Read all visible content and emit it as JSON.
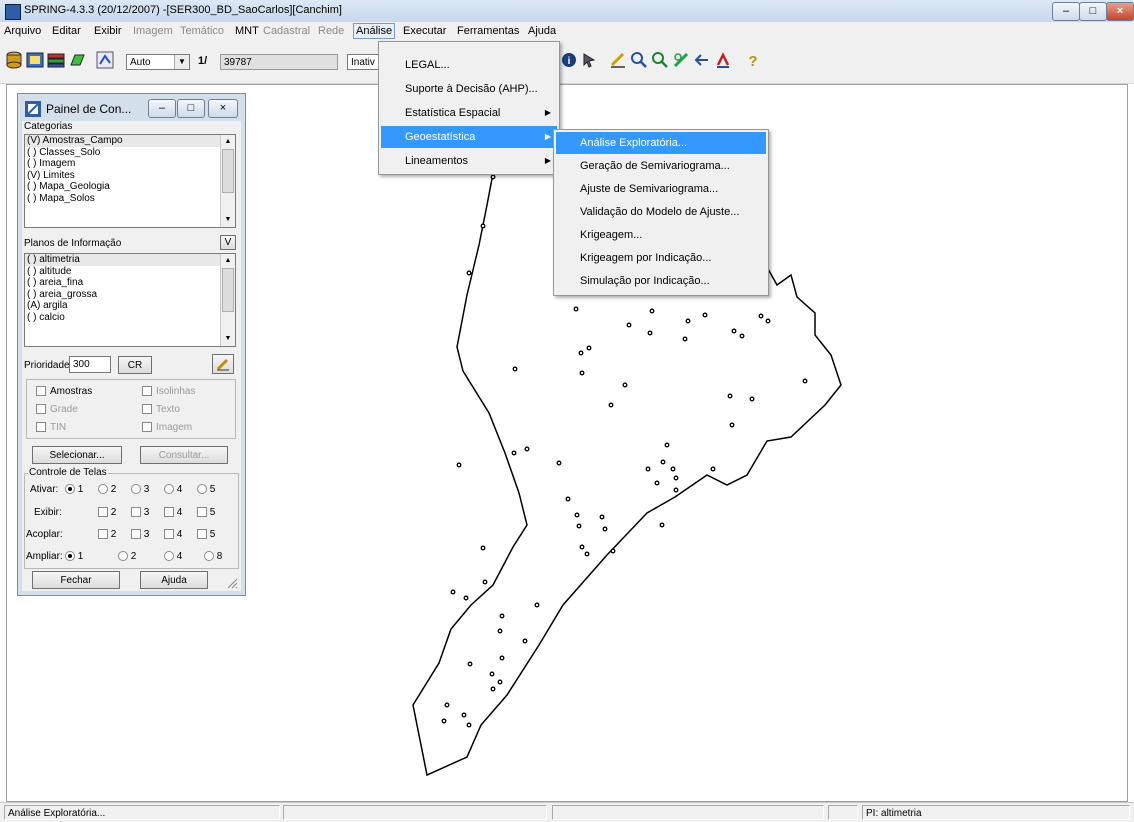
{
  "window": {
    "title": "SPRING-4.3.3 (20/12/2007) -[SER300_BD_SaoCarlos][Canchim]"
  },
  "menubar": {
    "items": [
      "Arquivo",
      "Editar",
      "Exibir",
      "Imagem",
      "Temático",
      "MNT",
      "Cadastral",
      "Rede",
      "Análise",
      "Executar",
      "Ferramentas",
      "Ajuda"
    ],
    "active": "Análise"
  },
  "toolbar": {
    "mode_combo": "Auto",
    "scale_prefix": "1/",
    "scale_value": "39787",
    "inactive_field": "Inativ"
  },
  "panel": {
    "title": "Painel de Con...",
    "categories_label": "Categorias",
    "categories": [
      "(V) Amostras_Campo",
      "( ) Classes_Solo",
      "( ) Imagem",
      "(V) Limites",
      "( ) Mapa_Geologia",
      "( ) Mapa_Solos"
    ],
    "planes_label": "Planos de Informação",
    "planes_button": "V",
    "planes": [
      "( ) altimetria",
      "( ) altitude",
      "( ) areia_fina",
      "( ) areia_grossa",
      "(A) argila",
      "( ) calcio"
    ],
    "priority_label": "Prioridade:",
    "priority_value": "300",
    "cr_button": "CR",
    "checks": {
      "amostras": "Amostras",
      "isolinhas": "Isolinhas",
      "grade": "Grade",
      "texto": "Texto",
      "tin": "TIN",
      "imagem": "Imagem"
    },
    "select_button": "Selecionar...",
    "query_button": "Consultar...",
    "screens_group": "Controle de Telas",
    "ativar_label": "Ativar:",
    "exibir_label": "Exibir:",
    "acoplar_label": "Acoplar:",
    "ampliar_label": "Ampliar:",
    "screen_numbers": [
      "1",
      "2",
      "3",
      "4",
      "5"
    ],
    "zoom_options": [
      "1",
      "2",
      "4",
      "8"
    ],
    "close_button": "Fechar",
    "help_button": "Ajuda"
  },
  "analise_menu": {
    "items": [
      "LEGAL...",
      "Suporte à Decisão (AHP)...",
      "Estatística Espacial",
      "Geoestatística",
      "Lineamentos"
    ],
    "highlighted": "Geoestatística"
  },
  "geo_menu": {
    "items": [
      "Análise Exploratória...",
      "Geração de Semivariograma...",
      "Ajuste de Semivariograma...",
      "Validação do Modelo de Ajuste...",
      "Krigeagem...",
      "Krigeagem por Indicação...",
      "Simulação por Indicação..."
    ],
    "highlighted": "Análise Exploratória..."
  },
  "statusbar": {
    "message": "Análise Exploratória...",
    "pi": "PI: altimetria"
  }
}
